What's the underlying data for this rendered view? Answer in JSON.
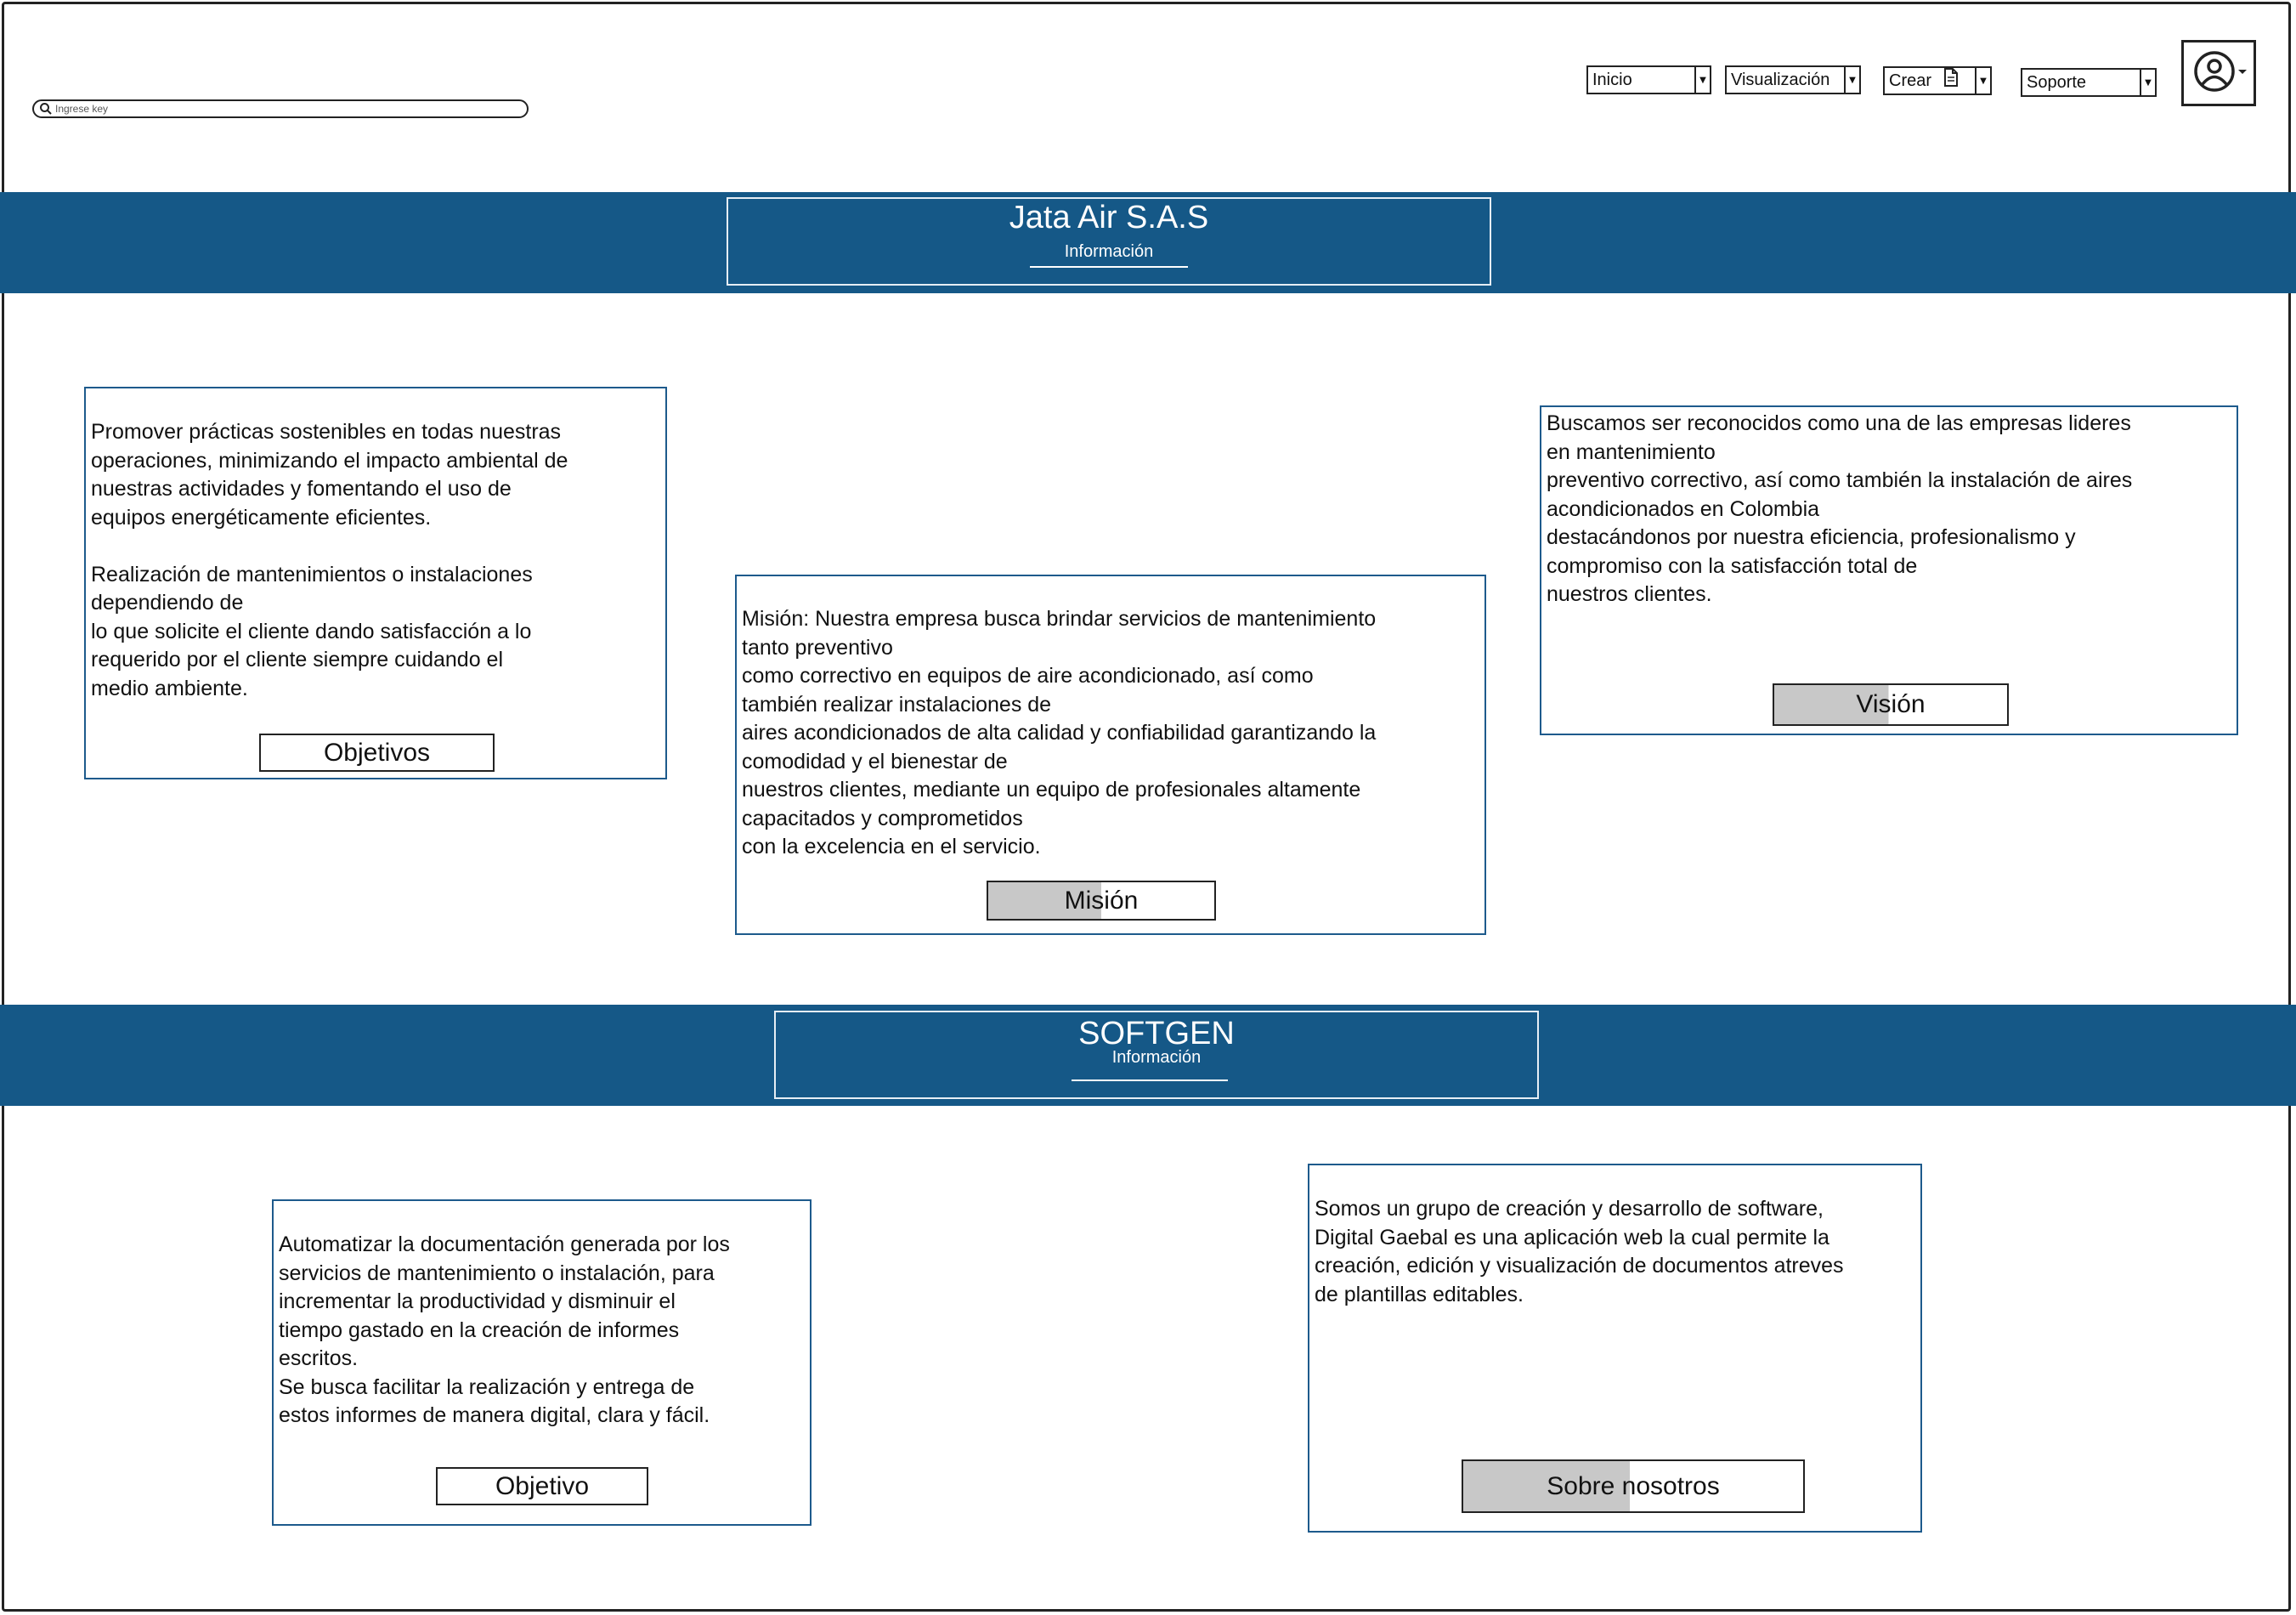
{
  "search": {
    "placeholder": "Ingrese key",
    "icon": "search-icon"
  },
  "nav": {
    "inicio": "Inicio",
    "visualizacion": "Visualización",
    "crear": "Crear",
    "soporte": "Soporte"
  },
  "user_menu": {
    "icon": "user-icon"
  },
  "company_band": {
    "title": "Jata Air S.A.S",
    "subtitle": "Información"
  },
  "company_cards": {
    "objetivos": {
      "text": "Promover prácticas sostenibles en todas nuestras\noperaciones, minimizando el impacto ambiental de\nnuestras actividades y fomentando el uso de\nequipos energéticamente eficientes.\n\nRealización de mantenimientos o instalaciones\ndependiendo de\nlo que solicite el cliente dando satisfacción a lo\nrequerido por el cliente siempre cuidando el\nmedio ambiente.",
      "button": "Objetivos"
    },
    "mision": {
      "text": "Misión: Nuestra empresa busca brindar servicios de mantenimiento\ntanto preventivo\ncomo correctivo en equipos de aire acondicionado, así como\ntambién realizar instalaciones de\naires acondicionados de alta calidad y confiabilidad garantizando la\ncomodidad y el bienestar de\nnuestros clientes, mediante un equipo de profesionales altamente\ncapacitados y comprometidos\ncon la excelencia en el servicio.",
      "button": "Misión",
      "button_progress": 0.5
    },
    "vision": {
      "text": "Buscamos ser reconocidos como una de las empresas lideres\nen mantenimiento\npreventivo correctivo, así como también la instalación de aires\nacondicionados en Colombia\ndestacándonos por nuestra eficiencia, profesionalismo y\ncompromiso con la satisfacción total de\nnuestros clientes.",
      "button": "Visión",
      "button_progress": 0.49
    }
  },
  "softgen_band": {
    "title": "SOFTGEN",
    "subtitle": "Información"
  },
  "softgen_cards": {
    "objetivo": {
      "text": "Automatizar la documentación generada por los\nservicios de mantenimiento o instalación, para\nincrementar la productividad y disminuir el\ntiempo gastado en la creación de informes\nescritos.\nSe busca facilitar la realización y entrega de\nestos informes de manera digital, clara y fácil.",
      "button": "Objetivo"
    },
    "sobre_nosotros": {
      "text": "Somos un grupo de creación y desarrollo de software,\nDigital Gaebal es una aplicación web la cual permite la\ncreación, edición y visualización de documentos atreves\nde plantillas editables.",
      "button": "Sobre nosotros",
      "button_progress": 0.49
    }
  },
  "colors": {
    "band": "#155887",
    "card_border": "#1d5a8c",
    "progress_fill": "#c8c8c8"
  }
}
